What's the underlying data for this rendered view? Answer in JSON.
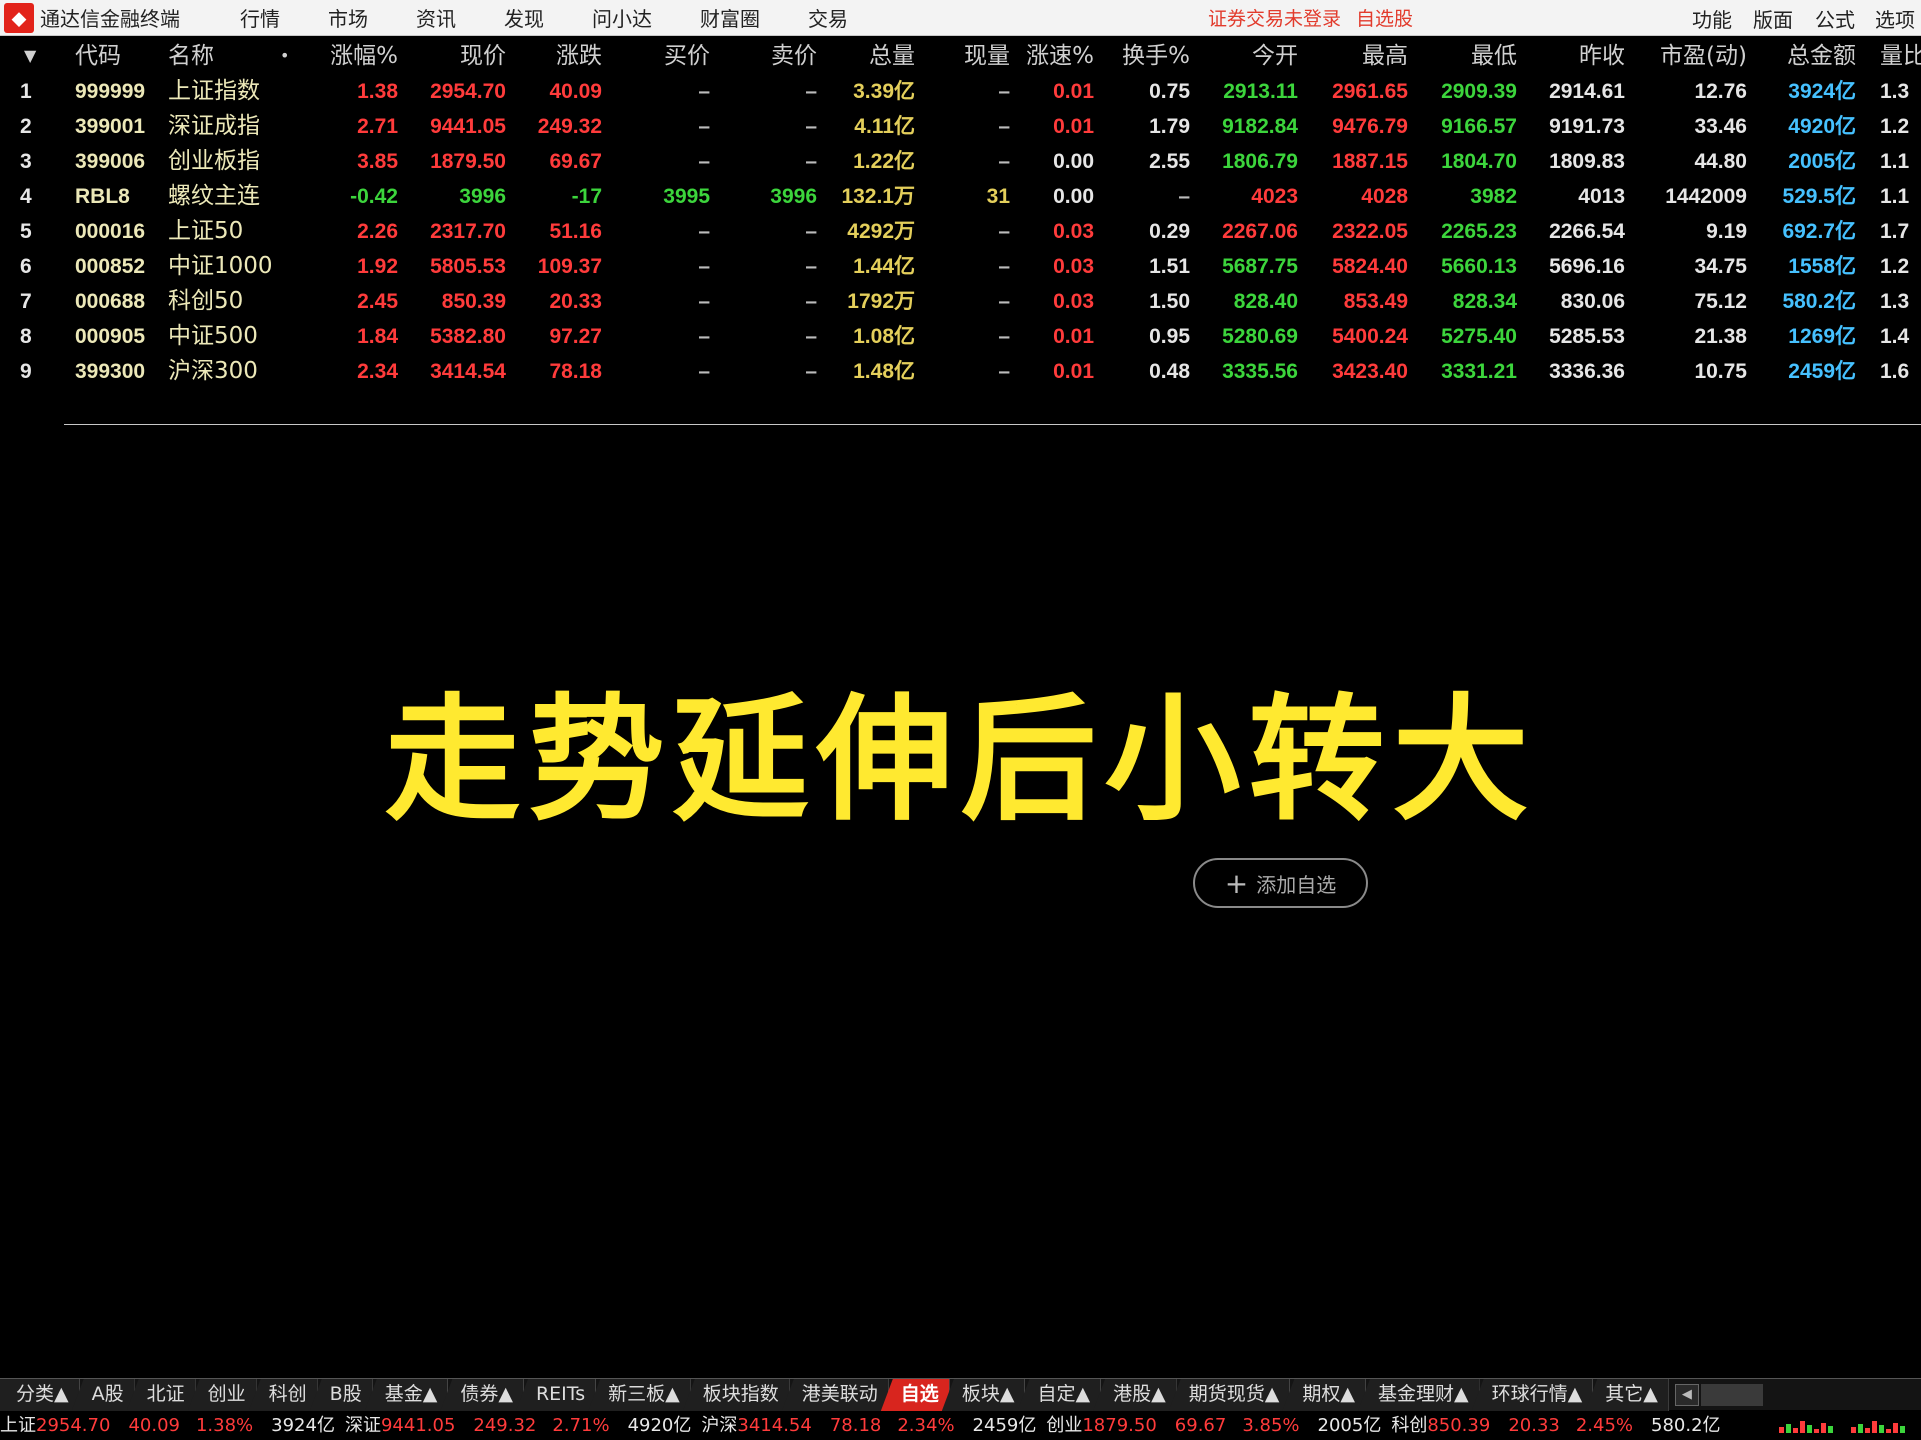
{
  "app": {
    "logo_glyph": "⬥",
    "title": "通达信金融终端"
  },
  "menu": [
    "行情",
    "市场",
    "资讯",
    "发现",
    "问小达",
    "财富圈",
    "交易"
  ],
  "login_status": "证券交易未登录",
  "self_select_link": "自选股",
  "right_menu": [
    "功能",
    "版面",
    "公式",
    "选项"
  ],
  "table": {
    "sort_arrow": "▼",
    "name_dot": "•",
    "headers": [
      "代码",
      "名称",
      "涨幅%",
      "现价",
      "涨跌",
      "买价",
      "卖价",
      "总量",
      "现量",
      "涨速%",
      "换手%",
      "今开",
      "最高",
      "最低",
      "昨收",
      "市盈(动)",
      "总金额",
      "量比"
    ],
    "rows": [
      {
        "idx": "1",
        "code": "999999",
        "name": "上证指数",
        "pct": "1.38",
        "price": "2954.70",
        "chg": "40.09",
        "bid": "–",
        "ask": "–",
        "vol": "3.39亿",
        "cur": "–",
        "speed": "0.01",
        "turn": "0.75",
        "open": "2913.11",
        "high": "2961.65",
        "low": "2909.39",
        "prev": "2914.61",
        "pe": "12.76",
        "amt": "3924亿",
        "vr": "1.3",
        "dir": "up",
        "speed_up": true,
        "open_up": false,
        "high_up": true,
        "low_up": false
      },
      {
        "idx": "2",
        "code": "399001",
        "name": "深证成指",
        "pct": "2.71",
        "price": "9441.05",
        "chg": "249.32",
        "bid": "–",
        "ask": "–",
        "vol": "4.11亿",
        "cur": "–",
        "speed": "0.01",
        "turn": "1.79",
        "open": "9182.84",
        "high": "9476.79",
        "low": "9166.57",
        "prev": "9191.73",
        "pe": "33.46",
        "amt": "4920亿",
        "vr": "1.2",
        "dir": "up",
        "speed_up": true,
        "open_up": false,
        "high_up": true,
        "low_up": false
      },
      {
        "idx": "3",
        "code": "399006",
        "name": "创业板指",
        "pct": "3.85",
        "price": "1879.50",
        "chg": "69.67",
        "bid": "–",
        "ask": "–",
        "vol": "1.22亿",
        "cur": "–",
        "speed": "0.00",
        "turn": "2.55",
        "open": "1806.79",
        "high": "1887.15",
        "low": "1804.70",
        "prev": "1809.83",
        "pe": "44.80",
        "amt": "2005亿",
        "vr": "1.1",
        "dir": "up",
        "speed_up": false,
        "open_up": false,
        "high_up": true,
        "low_up": false
      },
      {
        "idx": "4",
        "code": "RBL8",
        "name": "螺纹主连",
        "pct": "-0.42",
        "price": "3996",
        "chg": "-17",
        "bid": "3995",
        "ask": "3996",
        "vol": "132.1万",
        "cur": "31",
        "speed": "0.00",
        "turn": "–",
        "open": "4023",
        "high": "4028",
        "low": "3982",
        "prev": "4013",
        "pe": "1442009",
        "amt": "529.5亿",
        "vr": "1.1",
        "dir": "down",
        "speed_up": false,
        "open_up": true,
        "high_up": true,
        "low_up": false
      },
      {
        "idx": "5",
        "code": "000016",
        "name": "上证50",
        "pct": "2.26",
        "price": "2317.70",
        "chg": "51.16",
        "bid": "–",
        "ask": "–",
        "vol": "4292万",
        "cur": "–",
        "speed": "0.03",
        "turn": "0.29",
        "open": "2267.06",
        "high": "2322.05",
        "low": "2265.23",
        "prev": "2266.54",
        "pe": "9.19",
        "amt": "692.7亿",
        "vr": "1.7",
        "dir": "up",
        "speed_up": true,
        "open_up": true,
        "high_up": true,
        "low_up": false
      },
      {
        "idx": "6",
        "code": "000852",
        "name": "中证1000",
        "pct": "1.92",
        "price": "5805.53",
        "chg": "109.37",
        "bid": "–",
        "ask": "–",
        "vol": "1.44亿",
        "cur": "–",
        "speed": "0.03",
        "turn": "1.51",
        "open": "5687.75",
        "high": "5824.40",
        "low": "5660.13",
        "prev": "5696.16",
        "pe": "34.75",
        "amt": "1558亿",
        "vr": "1.2",
        "dir": "up",
        "speed_up": true,
        "open_up": false,
        "high_up": true,
        "low_up": false
      },
      {
        "idx": "7",
        "code": "000688",
        "name": "科创50",
        "pct": "2.45",
        "price": "850.39",
        "chg": "20.33",
        "bid": "–",
        "ask": "–",
        "vol": "1792万",
        "cur": "–",
        "speed": "0.03",
        "turn": "1.50",
        "open": "828.40",
        "high": "853.49",
        "low": "828.34",
        "prev": "830.06",
        "pe": "75.12",
        "amt": "580.2亿",
        "vr": "1.3",
        "dir": "up",
        "speed_up": true,
        "open_up": false,
        "high_up": true,
        "low_up": false
      },
      {
        "idx": "8",
        "code": "000905",
        "name": "中证500",
        "pct": "1.84",
        "price": "5382.80",
        "chg": "97.27",
        "bid": "–",
        "ask": "–",
        "vol": "1.08亿",
        "cur": "–",
        "speed": "0.01",
        "turn": "0.95",
        "open": "5280.69",
        "high": "5400.24",
        "low": "5275.40",
        "prev": "5285.53",
        "pe": "21.38",
        "amt": "1269亿",
        "vr": "1.4",
        "dir": "up",
        "speed_up": true,
        "open_up": false,
        "high_up": true,
        "low_up": false
      },
      {
        "idx": "9",
        "code": "399300",
        "name": "沪深300",
        "pct": "2.34",
        "price": "3414.54",
        "chg": "78.18",
        "bid": "–",
        "ask": "–",
        "vol": "1.48亿",
        "cur": "–",
        "speed": "0.01",
        "turn": "0.48",
        "open": "3335.56",
        "high": "3423.40",
        "low": "3331.21",
        "prev": "3336.36",
        "pe": "10.75",
        "amt": "2459亿",
        "vr": "1.6",
        "dir": "up",
        "speed_up": true,
        "open_up": false,
        "high_up": true,
        "low_up": false
      }
    ]
  },
  "overlay_title": "走势延伸后小转大",
  "add_watch": {
    "plus": "+",
    "label": "添加自选"
  },
  "tabs": [
    {
      "label": "分类▲",
      "active": false
    },
    {
      "label": "A股",
      "active": false
    },
    {
      "label": "北证",
      "active": false
    },
    {
      "label": "创业",
      "active": false
    },
    {
      "label": "科创",
      "active": false
    },
    {
      "label": "B股",
      "active": false
    },
    {
      "label": "基金▲",
      "active": false
    },
    {
      "label": "债券▲",
      "active": false
    },
    {
      "label": "REITs",
      "active": false
    },
    {
      "label": "新三板▲",
      "active": false
    },
    {
      "label": "板块指数",
      "active": false
    },
    {
      "label": "港美联动",
      "active": false
    },
    {
      "label": "自选",
      "active": true
    },
    {
      "label": "板块▲",
      "active": false
    },
    {
      "label": "自定▲",
      "active": false
    },
    {
      "label": "港股▲",
      "active": false
    },
    {
      "label": "期货现货▲",
      "active": false
    },
    {
      "label": "期权▲",
      "active": false
    },
    {
      "label": "基金理财▲",
      "active": false
    },
    {
      "label": "环球行情▲",
      "active": false
    },
    {
      "label": "其它▲",
      "active": false
    }
  ],
  "tab_scroll_left": "◀",
  "index_strip": [
    {
      "name": "上证",
      "price": "2954.70",
      "chg": "40.09",
      "pct": "1.38%",
      "amt": "3924亿"
    },
    {
      "name": "深证",
      "price": "9441.05",
      "chg": "249.32",
      "pct": "2.71%",
      "amt": "4920亿"
    },
    {
      "name": "沪深",
      "price": "3414.54",
      "chg": "78.18",
      "pct": "2.34%",
      "amt": "2459亿"
    },
    {
      "name": "创业",
      "price": "1879.50",
      "chg": "69.67",
      "pct": "3.85%",
      "amt": "2005亿"
    },
    {
      "name": "科创",
      "price": "850.39",
      "chg": "20.33",
      "pct": "2.45%",
      "amt": "580.2亿"
    }
  ],
  "colors": {
    "up": "#ff3b3b",
    "down": "#3cd53c",
    "volume": "#e4cf5b",
    "amount": "#46c1ff",
    "title": "#ffe930",
    "active_tab": "#d8251e"
  }
}
